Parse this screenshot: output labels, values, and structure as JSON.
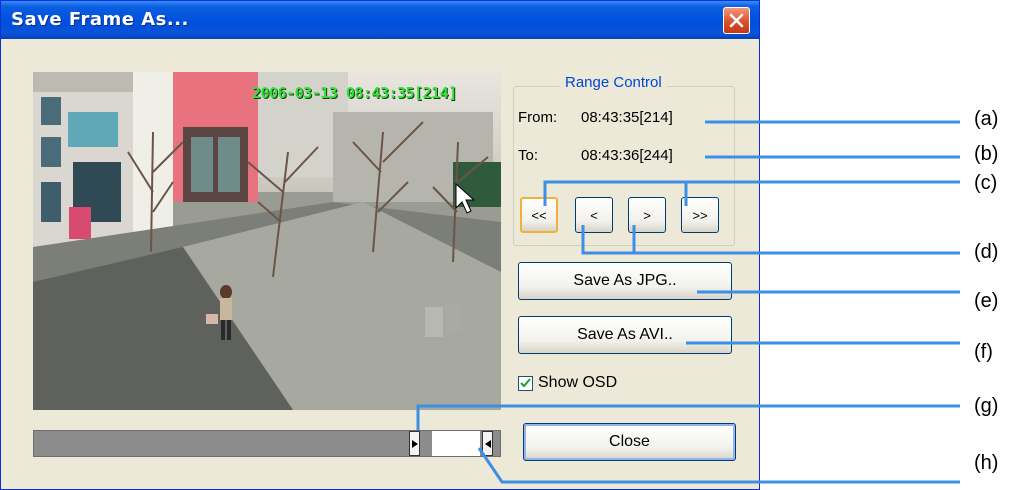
{
  "window": {
    "title": "Save Frame As..."
  },
  "video": {
    "osd_timestamp": "2006-03-13 08:43:35[214]"
  },
  "range_control": {
    "title": "Range Control",
    "from_label": "From:",
    "from_value": "08:43:35[214]",
    "to_label": "To:",
    "to_value": "08:43:36[244]"
  },
  "nav_buttons": {
    "first": "<<",
    "prev": "<",
    "next": ">",
    "last": ">>"
  },
  "actions": {
    "save_jpg": "Save As JPG..",
    "save_avi": "Save As AVI..",
    "close": "Close"
  },
  "options": {
    "show_osd_label": "Show OSD",
    "show_osd_checked": true
  },
  "callouts": [
    "(a)",
    "(b)",
    "(c)",
    "(d)",
    "(e)",
    "(f)",
    "(g)",
    "(h)"
  ],
  "colors": {
    "callout_line": "#3d8fe6",
    "titlebar": "#0050dd",
    "osd_text": "#35e03a"
  }
}
